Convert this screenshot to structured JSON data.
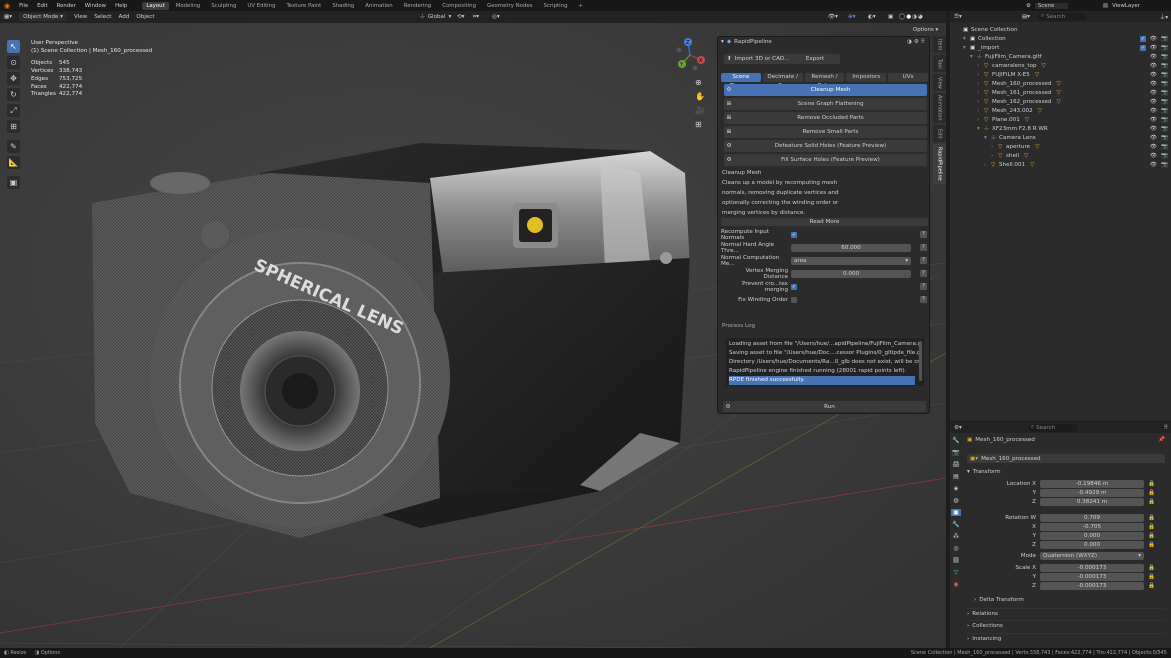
{
  "topbar": {
    "menus": [
      "File",
      "Edit",
      "Render",
      "Window",
      "Help"
    ],
    "workspaces": [
      "Layout",
      "Modeling",
      "Sculpting",
      "UV Editing",
      "Texture Paint",
      "Shading",
      "Animation",
      "Rendering",
      "Compositing",
      "Geometry Nodes",
      "Scripting"
    ],
    "active_workspace": "Layout",
    "plus": "+",
    "scene": "Scene",
    "view_layer": "ViewLayer"
  },
  "viewport_header": {
    "mode": "Object Mode",
    "menus": [
      "View",
      "Select",
      "Add",
      "Object"
    ],
    "transform": "Global",
    "options": "Options"
  },
  "viewport": {
    "perspective": "User Perspective",
    "collection_path": "(1) Scene Collection | Mesh_160_processed",
    "stats": [
      {
        "k": "Objects",
        "v": "545"
      },
      {
        "k": "Vertices",
        "v": "338,743"
      },
      {
        "k": "Edges",
        "v": "753,725"
      },
      {
        "k": "Faces",
        "v": "422,774"
      },
      {
        "k": "Triangles",
        "v": "422,774"
      }
    ],
    "lens_text": "SPHERICAL LENS",
    "axes": {
      "x": "X",
      "y": "Y",
      "z": "Z"
    }
  },
  "panel": {
    "title": "RapidPipeline",
    "import_btn": "Import 3D or CAD...",
    "export_btn": "Export",
    "tabs": [
      "Scene Cleanup",
      "Decimate / B...",
      "Remesh / Bake",
      "Impostors",
      "UVs"
    ],
    "ops": [
      "Cleanup Mesh",
      "Scene Graph Flattening",
      "Remove Occluded Parts",
      "Remove Small Parts",
      "Defeature Solid Holes (Feature Preview)",
      "Fill Surface Holes (Feature Preview)"
    ],
    "desc_title": "Cleanup Mesh",
    "desc_lines": [
      "Cleans up a model by recomputing mesh",
      "normals, removing duplicate vertices and",
      "optionally correcting the winding order or",
      "merging vertices by distance."
    ],
    "read_more": "Read More",
    "props": [
      {
        "label": "Recompute Input Normals",
        "type": "check",
        "value": true
      },
      {
        "label": "Normal Hard Angle Thre...",
        "type": "num",
        "value": "60.000"
      },
      {
        "label": "Normal Computation Me...",
        "type": "enum",
        "value": "area"
      },
      {
        "label": "Vertex Merging Distance",
        "type": "num",
        "value": "0.000"
      },
      {
        "label": "Prevent cro...tex merging",
        "type": "check",
        "value": true
      },
      {
        "label": "Fix Winding Order",
        "type": "check",
        "value": false
      }
    ],
    "qm": "?",
    "log_title": "Process Log",
    "log": [
      "Loading asset from file \"/Users/hue/...apidPipeline/FujiFilm_Camera.gltf\".",
      "Saving asset to file \"/Users/hue/Doc....cessor Plugins/0_gltipde_file.glb\".",
      "Directory /Users/hue/Documents/Ra...0_glb does not exist, will be created.",
      "RapidPipeline engine finished running (28001 rapid points left).",
      "RPDE finished successfully."
    ],
    "run": "Run"
  },
  "sidetabs": [
    "Item",
    "Tool",
    "View",
    "Animation",
    "Edit",
    "RapidPipeline"
  ],
  "outliner": {
    "search": "Search",
    "rows": [
      {
        "label": "Scene Collection",
        "d": 0,
        "ic": "collection"
      },
      {
        "label": "Collection",
        "d": 1,
        "ic": "collection"
      },
      {
        "label": "_import",
        "d": 1,
        "ic": "collection"
      },
      {
        "label": "FujiFilm_Camera.gltf",
        "d": 2,
        "ic": "object"
      },
      {
        "label": "cameralens_top",
        "d": 3,
        "ic": "mesh"
      },
      {
        "label": "FUJIFILM X-E5",
        "d": 3,
        "ic": "mesh"
      },
      {
        "label": "Mesh_160_processed",
        "d": 3,
        "ic": "mesh"
      },
      {
        "label": "Mesh_161_processed",
        "d": 3,
        "ic": "mesh"
      },
      {
        "label": "Mesh_162_processed",
        "d": 3,
        "ic": "mesh"
      },
      {
        "label": "Mesh_243.002",
        "d": 3,
        "ic": "mesh"
      },
      {
        "label": "Plane.001",
        "d": 3,
        "ic": "mesh"
      },
      {
        "label": "XF23mm F2.8 R WR",
        "d": 3,
        "ic": "object"
      },
      {
        "label": "Camera Lens",
        "d": 4,
        "ic": "object"
      },
      {
        "label": "aperture",
        "d": 5,
        "ic": "mesh"
      },
      {
        "label": "shell",
        "d": 5,
        "ic": "mesh"
      },
      {
        "label": "Shell.001",
        "d": 4,
        "ic": "mesh"
      }
    ]
  },
  "properties": {
    "search": "Search",
    "object": "Mesh_160_processed",
    "data": "Mesh_160_processed",
    "transform": "Transform",
    "location_label": "Location",
    "location": [
      {
        "a": "X",
        "v": "-0.19846 m"
      },
      {
        "a": "Y",
        "v": "-0.4929 m"
      },
      {
        "a": "Z",
        "v": "0.38241 m"
      }
    ],
    "rotation_label": "Rotation",
    "rotation": [
      {
        "a": "W",
        "v": "0.709"
      },
      {
        "a": "X",
        "v": "-0.705"
      },
      {
        "a": "Y",
        "v": "0.000"
      },
      {
        "a": "Z",
        "v": "0.000"
      }
    ],
    "mode_label": "Mode",
    "mode": "Quaternion (WXYZ)",
    "scale_label": "Scale",
    "scale": [
      {
        "a": "X",
        "v": "-0.000173"
      },
      {
        "a": "Y",
        "v": "-0.000173"
      },
      {
        "a": "Z",
        "v": "-0.000173"
      }
    ],
    "sections": [
      "Delta Transform",
      "Relations",
      "Collections",
      "Instancing"
    ]
  },
  "status": {
    "left": [
      "Resize",
      "Options"
    ],
    "right": "Scene Collection | Mesh_160_processed | Verts:338,743 | Faces:422,774 | Tris:422,774 | Objects:0/545"
  }
}
